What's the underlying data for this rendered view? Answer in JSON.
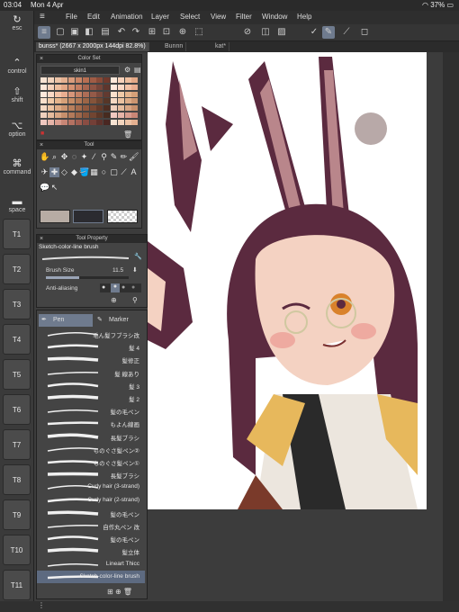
{
  "status": {
    "time": "03:04",
    "date": "Mon 4 Apr",
    "battery": "37%"
  },
  "menu": [
    "File",
    "Edit",
    "Animation",
    "Layer",
    "Select",
    "View",
    "Filter",
    "Window",
    "Help"
  ],
  "tabs": [
    {
      "label": "bunss* (2667 x 2000px 144dpi 82.8%)"
    },
    {
      "label": "Bunnn"
    },
    {
      "label": "kat*"
    }
  ],
  "modifiers": [
    {
      "label": "esc",
      "icon": "↻"
    },
    {
      "label": "control",
      "icon": "⌃"
    },
    {
      "label": "shift",
      "icon": "⇧"
    },
    {
      "label": "option",
      "icon": "⌥"
    },
    {
      "label": "command",
      "icon": "⌘"
    },
    {
      "label": "space",
      "icon": "▬"
    }
  ],
  "tkeys": [
    "T1",
    "T2",
    "T3",
    "T4",
    "T5",
    "T6",
    "T7",
    "T8",
    "T9",
    "T10",
    "T11"
  ],
  "color_set": {
    "title": "Color Set",
    "set_name": "skin1"
  },
  "tool_panel": {
    "title": "Tool"
  },
  "tool_property": {
    "title": "Tool Property",
    "brush_name": "Sketch-color-line brush",
    "brush_size_label": "Brush Size",
    "brush_size_value": "11.5",
    "anti_aliasing_label": "Anti-aliasing"
  },
  "subtool": {
    "tabs": [
      "Pen",
      "Marker"
    ],
    "brushes": [
      "毛ん髪フブラシ改",
      "髪 4",
      "髪修正",
      "髪 線あり",
      "髪 3",
      "髪 2",
      "髪の毛ペン",
      "もよん線画",
      "長髪ブラシ",
      "ものぐさ髪ペン②",
      "ものぐさ髪ペン①",
      "長髪ブラシ",
      "Curly hair (3-strand)",
      "Curly hair (2-strand)",
      "髪の毛ペン",
      "自作丸ペン 改",
      "髪の毛ペン",
      "髪立体",
      "Lineart Thicc",
      "Sketch-color-line brush"
    ],
    "selected_index": 19
  },
  "colors": {
    "accent": "#5d6a80",
    "canvas": "#ffffff",
    "hair": "#5b2a3f",
    "ear_inner": "#b9868b",
    "skin": "#f4d2c2",
    "circle": "#b8a9a8"
  }
}
